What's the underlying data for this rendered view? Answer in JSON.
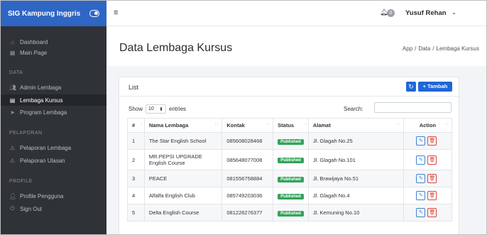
{
  "brand": {
    "title": "SIG Kampung Inggris",
    "toggle_icon": "toggle-icon"
  },
  "sidebar": {
    "top": [
      {
        "label": "Dashboard",
        "icon": "home-icon"
      },
      {
        "label": "Main Page",
        "icon": "grid-icon"
      }
    ],
    "sections": {
      "data": "DATA",
      "pelaporan": "PELAPORAN",
      "profile": "PROFILE"
    },
    "data_items": [
      {
        "label": "Admin Lembaga",
        "icon": "users-icon"
      },
      {
        "label": "Lembaga Kursus",
        "icon": "document-icon"
      },
      {
        "label": "Program Lembaga",
        "icon": "send-icon"
      }
    ],
    "pelaporan_items": [
      {
        "label": "Pelaporan Lembaga",
        "icon": "warning-icon"
      },
      {
        "label": "Pelaporan Ulasan",
        "icon": "warning-icon"
      }
    ],
    "profile_items": [
      {
        "label": "Profile Pengguna",
        "icon": "user-icon"
      },
      {
        "label": "Sign Out",
        "icon": "power-icon"
      }
    ]
  },
  "topbar": {
    "notification_count": "0",
    "user_name": "Yusuf Rehan"
  },
  "page": {
    "title": "Data Lembaga Kursus",
    "breadcrumb": [
      "App",
      "Data",
      "Lembaga Kursus"
    ]
  },
  "card": {
    "title": "List",
    "add_label": "+ Tambah",
    "show_label": "Show",
    "entries_value": "10",
    "entries_label": "entries",
    "search_label": "Search:",
    "search_value": ""
  },
  "table": {
    "headers": [
      "#",
      "Nama Lembaga",
      "Kontak",
      "Status",
      "Alamat",
      "Action"
    ],
    "rows": [
      {
        "no": "1",
        "nama": "The Star English School",
        "kontak": "085608028468",
        "status": "Published",
        "alamat": "Jl. Glagah No.25"
      },
      {
        "no": "2",
        "nama": "MR.PEPSI UPGRADE English Course",
        "kontak": "085648077008",
        "status": "Published",
        "alamat": "Jl. Glagah No.101"
      },
      {
        "no": "3",
        "nama": "PEACE",
        "kontak": "081556758884",
        "status": "Published",
        "alamat": "Jl. Brawijaya No.51"
      },
      {
        "no": "4",
        "nama": "Alfalfa English Club",
        "kontak": "085749203036",
        "status": "Published",
        "alamat": "Jl. Glagah No.4"
      },
      {
        "no": "5",
        "nama": "Delta English Course",
        "kontak": "081226276377",
        "status": "Published",
        "alamat": "Jl. Kemuning No.10"
      }
    ]
  },
  "colors": {
    "sidebar": "#2f3237",
    "brand": "#2f66c4",
    "primary": "#1f66d9",
    "published": "#33a35a"
  }
}
